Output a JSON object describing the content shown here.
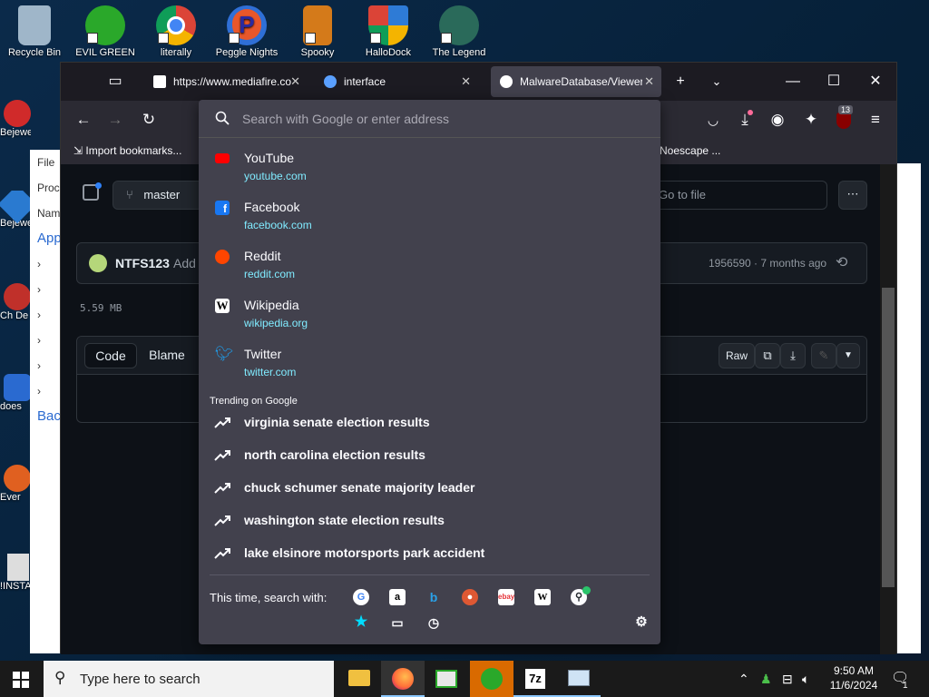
{
  "desktop": {
    "top_icons": [
      {
        "label": "Recycle Bin",
        "icon": "recycle-bin-icon",
        "color": "#9fb6c9"
      },
      {
        "label": "EVIL GREEN",
        "icon": "green-people-icon",
        "color": "#2aa82a"
      },
      {
        "label": "literally",
        "icon": "chrome-icon",
        "color": "#db4437"
      },
      {
        "label": "Peggle Nights",
        "icon": "peggle-icon",
        "color": "#2f6fd6"
      },
      {
        "label": "Spooky",
        "icon": "spooky-icon",
        "color": "#d47a1a"
      },
      {
        "label": "HalloDock",
        "icon": "windows-shield-icon",
        "color": "#2e7bd6"
      },
      {
        "label": "The Legend",
        "icon": "game-character-icon",
        "color": "#2a6a5a"
      }
    ],
    "left_icons": [
      "Bejeweled De",
      "Bejeweled De",
      "Ch De",
      "does",
      "Ever",
      "!INSTA"
    ]
  },
  "explorer": {
    "rows": [
      "File",
      "Proc",
      "Nam",
      "App",
      "",
      "",
      "",
      "",
      "",
      "Bac",
      "",
      "",
      "",
      ""
    ]
  },
  "browser": {
    "tabs": [
      {
        "title": "https://www.mediafire.co",
        "fav_color": "#ffffff"
      },
      {
        "title": "interface",
        "fav_color": "#5aa0ff"
      },
      {
        "title": "MalwareDatabase/Viewer",
        "fav_color": "#ffffff"
      }
    ],
    "toolbar_badge": "13",
    "bookmarks": {
      "import_label": "Import bookmarks...",
      "right_item": "Noescape ..."
    },
    "url": {
      "placeholder": "Search with Google or enter address",
      "value": ""
    }
  },
  "github": {
    "branch": "master",
    "go_to_file": "Go to file",
    "author": "NTFS123",
    "commit_msg": "Add",
    "commit_info": "1956590 · 7 months ago",
    "file_size": "5.59 MB",
    "view_tabs": {
      "code": "Code",
      "blame": "Blame"
    },
    "raw_label": "Raw"
  },
  "dropdown": {
    "suggestions": [
      {
        "title": "YouTube",
        "url": "youtube.com",
        "fav_color": "#ff0000",
        "icon": "youtube-icon"
      },
      {
        "title": "Facebook",
        "url": "facebook.com",
        "fav_color": "#1877f2",
        "icon": "facebook-icon"
      },
      {
        "title": "Reddit",
        "url": "reddit.com",
        "fav_color": "#ff4500",
        "icon": "reddit-icon"
      },
      {
        "title": "Wikipedia",
        "url": "wikipedia.org",
        "fav_color": "#ffffff",
        "icon": "wikipedia-icon"
      },
      {
        "title": "Twitter",
        "url": "twitter.com",
        "fav_color": "#1da1f2",
        "icon": "twitter-icon"
      }
    ],
    "trending_header": "Trending on Google",
    "trending": [
      "virginia senate election results",
      "north carolina election results",
      "chuck schumer senate majority leader",
      "washington state election results",
      "lake elsinore motorsports park accident"
    ],
    "search_with_label": "This time, search with:",
    "engines": [
      "google-icon",
      "amazon-icon",
      "bing-icon",
      "duckduckgo-icon",
      "ebay-icon",
      "wikipedia-icon",
      "github-search-icon"
    ],
    "bottom_icons": [
      "bookmarks-star-icon",
      "tabs-icon",
      "history-icon"
    ]
  },
  "taskbar": {
    "search_placeholder": "Type here to search",
    "time": "9:50 AM",
    "date": "11/6/2024",
    "notification_count": "1"
  }
}
